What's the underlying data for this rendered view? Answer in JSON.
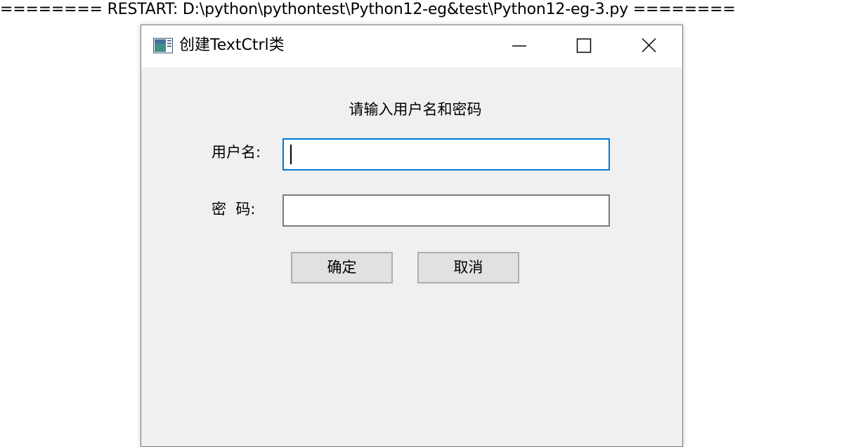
{
  "shell": {
    "restart_line": "======== RESTART: D:\\python\\pythontest\\Python12-eg&test\\Python12-eg-3.py ========"
  },
  "window": {
    "title": "创建TextCtrl类",
    "icon": "app-window-icon",
    "controls": {
      "minimize_icon": "minimize-icon",
      "maximize_icon": "maximize-icon",
      "close_icon": "close-icon"
    }
  },
  "form": {
    "heading": "请输入用户名和密码",
    "username_label": "用户名:",
    "username_value": "",
    "password_label": "密  码:",
    "password_value": "",
    "ok_label": "确定",
    "cancel_label": "取消"
  },
  "colors": {
    "focus_border": "#0078d7",
    "panel_bg": "#f0f0f0",
    "button_bg": "#e1e1e1"
  }
}
